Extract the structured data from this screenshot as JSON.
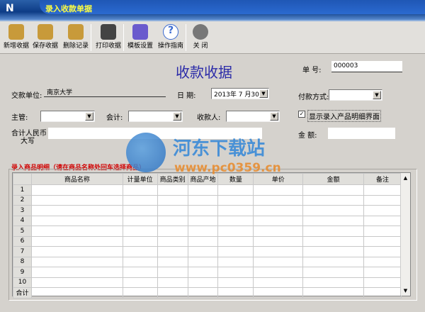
{
  "window": {
    "title": "录入收款单据"
  },
  "toolbar": [
    {
      "label": "新增收据",
      "icon": "database-add-icon",
      "color": "#c89a3a"
    },
    {
      "label": "保存收据",
      "icon": "database-save-icon",
      "color": "#c89a3a"
    },
    {
      "label": "删除记录",
      "icon": "database-delete-icon",
      "color": "#c89a3a"
    },
    {
      "label": "打印收据",
      "icon": "printer-icon",
      "color": "#444444"
    },
    {
      "label": "模板设置",
      "icon": "template-tools-icon",
      "color": "#6a5acd"
    },
    {
      "label": "操作指南",
      "icon": "help-icon",
      "color": "#3a6ad0"
    },
    {
      "label": "关  闭",
      "icon": "power-icon",
      "color": "#777777"
    }
  ],
  "form": {
    "heading": "收款收据",
    "number_label": "单  号:",
    "number_value": "000003",
    "payer_label": "交款单位:",
    "payer_value": "南京大学",
    "date_label": "日    期:",
    "date_value": "2013年 7 月30日",
    "payment_label": "付款方式:",
    "payment_value": "",
    "supervisor_label": "主管:",
    "accountant_label": "会计:",
    "payee_label": "收款人:",
    "show_detail_label": "显示录入产品明细界面",
    "show_detail_checked": true,
    "total_cn_label_1": "合计人民币",
    "total_cn_label_2": "大写",
    "total_cn_value": "",
    "amount_label": "金  额:",
    "amount_value": ""
  },
  "detail": {
    "title": "录入商品明细（请在商品名称处回车选择商品）",
    "columns": [
      "商品名称",
      "计量单位",
      "商品类别",
      "商品产地",
      "数量",
      "单价",
      "金额",
      "备注"
    ],
    "rows": [
      "1",
      "2",
      "3",
      "4",
      "5",
      "6",
      "7",
      "8",
      "9",
      "10"
    ],
    "total_row": "合计"
  },
  "watermark": {
    "name": "河东下载站",
    "url": "www.pc0359.cn"
  }
}
